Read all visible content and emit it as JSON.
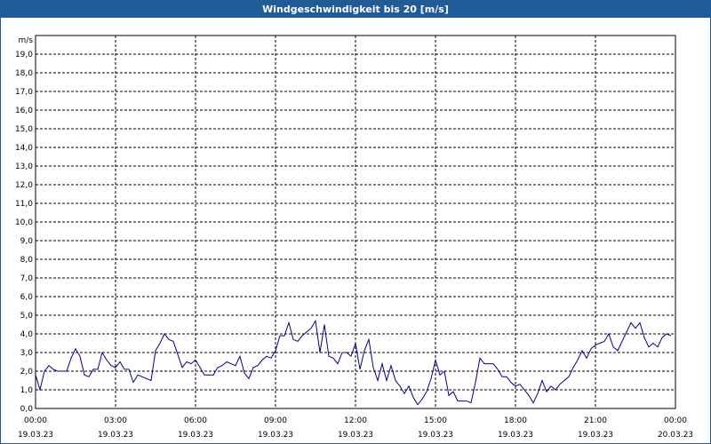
{
  "window": {
    "title": "Windgeschwindigkeit bis 20 [m/s]"
  },
  "colors": {
    "titlebar": "#1f5b96",
    "line": "#00008b",
    "grid": "#000000"
  },
  "chart_data": {
    "type": "line",
    "title": "Windgeschwindigkeit bis 20 [m/s]",
    "ylabel": "m/s",
    "xlabel": "",
    "ylim": [
      0,
      20
    ],
    "yticks": [
      "0,0",
      "1,0",
      "2,0",
      "3,0",
      "4,0",
      "5,0",
      "6,0",
      "7,0",
      "8,0",
      "9,0",
      "10,0",
      "11,0",
      "12,0",
      "13,0",
      "14,0",
      "15,0",
      "16,0",
      "17,0",
      "18,0",
      "19,0"
    ],
    "xlim": [
      "19.03.23 00:00",
      "20.03.23 00:00"
    ],
    "xticks": [
      {
        "time": "00:00",
        "date": "19.03.23"
      },
      {
        "time": "03:00",
        "date": "19.03.23"
      },
      {
        "time": "06:00",
        "date": "19.03.23"
      },
      {
        "time": "09:00",
        "date": "19.03.23"
      },
      {
        "time": "12:00",
        "date": "19.03.23"
      },
      {
        "time": "15:00",
        "date": "19.03.23"
      },
      {
        "time": "18:00",
        "date": "19.03.23"
      },
      {
        "time": "21:00",
        "date": "19.03.23"
      },
      {
        "time": "00:00",
        "date": "20.03.23"
      }
    ],
    "grid": true,
    "series": [
      {
        "x": [
          "00:00",
          "00:10",
          "00:20",
          "00:30",
          "00:40",
          "00:50",
          "01:00",
          "01:10",
          "01:20",
          "01:30",
          "01:40",
          "01:50",
          "02:00",
          "02:10",
          "02:20",
          "02:30",
          "02:40",
          "02:50",
          "03:00",
          "03:10",
          "03:20",
          "03:30",
          "03:40",
          "03:50",
          "04:00",
          "04:10",
          "04:20",
          "04:30",
          "04:40",
          "04:50",
          "05:00",
          "05:10",
          "05:20",
          "05:30",
          "05:40",
          "05:50",
          "06:00",
          "06:10",
          "06:20",
          "06:30",
          "06:40",
          "06:50",
          "07:00",
          "07:10",
          "07:20",
          "07:30",
          "07:40",
          "07:50",
          "08:00",
          "08:10",
          "08:20",
          "08:30",
          "08:40",
          "08:50",
          "09:00",
          "09:10",
          "09:20",
          "09:30",
          "09:40",
          "09:50",
          "10:00",
          "10:10",
          "10:20",
          "10:30",
          "10:40",
          "10:50",
          "11:00",
          "11:10",
          "11:20",
          "11:30",
          "11:40",
          "11:50",
          "12:00",
          "12:10",
          "12:20",
          "12:30",
          "12:40",
          "12:50",
          "13:00",
          "13:10",
          "13:20",
          "13:30",
          "13:40",
          "13:50",
          "14:00",
          "14:10",
          "14:20",
          "14:30",
          "14:40",
          "14:50",
          "15:00",
          "15:10",
          "15:20",
          "15:30",
          "15:40",
          "15:50",
          "16:00",
          "16:10",
          "16:20",
          "16:30",
          "16:40",
          "16:50",
          "17:00",
          "17:10",
          "17:20",
          "17:30",
          "17:40",
          "17:50",
          "18:00",
          "18:10",
          "18:20",
          "18:30",
          "18:40",
          "18:50",
          "19:00",
          "19:10",
          "19:20",
          "19:30",
          "19:40",
          "19:50",
          "20:00",
          "20:10",
          "20:20",
          "20:30",
          "20:40",
          "20:50",
          "21:00",
          "21:10",
          "21:20",
          "21:30",
          "21:40",
          "21:50",
          "22:00",
          "22:10",
          "22:20",
          "22:30",
          "22:40",
          "22:50",
          "23:00",
          "23:10",
          "23:20",
          "23:30",
          "23:40",
          "23:50"
        ],
        "values": [
          1.8,
          1.0,
          2.0,
          2.3,
          2.1,
          2.0,
          2.0,
          2.0,
          2.7,
          3.2,
          2.8,
          1.8,
          1.7,
          2.1,
          2.1,
          3.0,
          2.6,
          2.3,
          2.2,
          2.5,
          2.1,
          2.1,
          1.4,
          1.8,
          1.7,
          1.6,
          1.5,
          3.1,
          3.5,
          4.0,
          3.7,
          3.6,
          2.9,
          2.2,
          2.5,
          2.4,
          2.6,
          2.2,
          1.8,
          1.8,
          1.8,
          2.2,
          2.3,
          2.5,
          2.4,
          2.3,
          2.8,
          1.9,
          1.6,
          2.2,
          2.3,
          2.6,
          2.8,
          2.7,
          3.1,
          3.9,
          3.9,
          4.6,
          3.7,
          3.6,
          3.9,
          4.1,
          4.3,
          4.7,
          3.0,
          4.5,
          2.8,
          2.7,
          2.4,
          3.0,
          3.0,
          2.8,
          3.5,
          2.1,
          3.1,
          3.7,
          2.2,
          1.5,
          2.4,
          1.5,
          2.3,
          1.5,
          1.2,
          0.8,
          1.2,
          0.6,
          0.2,
          0.5,
          0.9,
          1.6,
          2.6,
          1.8,
          2.0,
          0.7,
          0.9,
          0.4,
          0.4,
          0.4,
          0.3,
          1.4,
          2.7,
          2.4,
          2.4,
          2.4,
          2.1,
          1.7,
          1.7,
          1.4,
          1.2,
          1.3,
          1.0,
          0.7,
          0.3,
          0.8,
          1.5,
          0.9,
          1.2,
          1.0,
          1.3,
          1.5,
          1.7,
          2.2,
          2.6,
          3.1,
          2.7,
          3.2,
          3.4,
          3.5,
          3.6,
          4.0,
          3.3,
          3.1,
          3.6,
          4.1,
          4.6,
          4.3,
          4.6,
          3.8,
          3.3,
          3.5,
          3.3,
          3.8,
          4.0,
          3.9
        ]
      }
    ]
  }
}
